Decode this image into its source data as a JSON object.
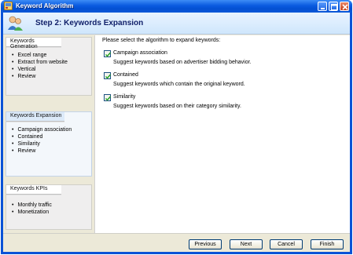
{
  "window": {
    "title": "Keyword Algorithm"
  },
  "header": {
    "title": "Step 2: Keywords Expansion"
  },
  "sidebar": {
    "groups": [
      {
        "title": "Keywords Generation",
        "active": false,
        "items": [
          "Excel range",
          "Extract from website",
          "Vertical",
          "Review"
        ]
      },
      {
        "title": "Keywords Expansion",
        "active": true,
        "items": [
          "Campaign association",
          "Contained",
          "Similarity",
          "Review"
        ]
      },
      {
        "title": "Keywords KPIs",
        "active": false,
        "items": [
          "Monthly traffic",
          "Monetization"
        ]
      }
    ]
  },
  "main": {
    "instruction": "Please select the algorithm to expand keywords:",
    "options": [
      {
        "label": "Campaign association",
        "description": "Suggest keywords based on advertiser bidding behavior.",
        "checked": true
      },
      {
        "label": "Contained",
        "description": "Suggest keywords which contain the original keyword.",
        "checked": true
      },
      {
        "label": "Similarity",
        "description": "Suggest keywords based on their category similarity.",
        "checked": true
      }
    ]
  },
  "footer": {
    "previous_label": "Previous",
    "next_label": "Next",
    "cancel_label": "Cancel",
    "finish_label": "Finish"
  },
  "colors": {
    "titlebar": "#0a5ae0",
    "header_bg": "#cfe6fc",
    "header_text": "#10206a",
    "active_group_bg": "#f3f7fb"
  }
}
